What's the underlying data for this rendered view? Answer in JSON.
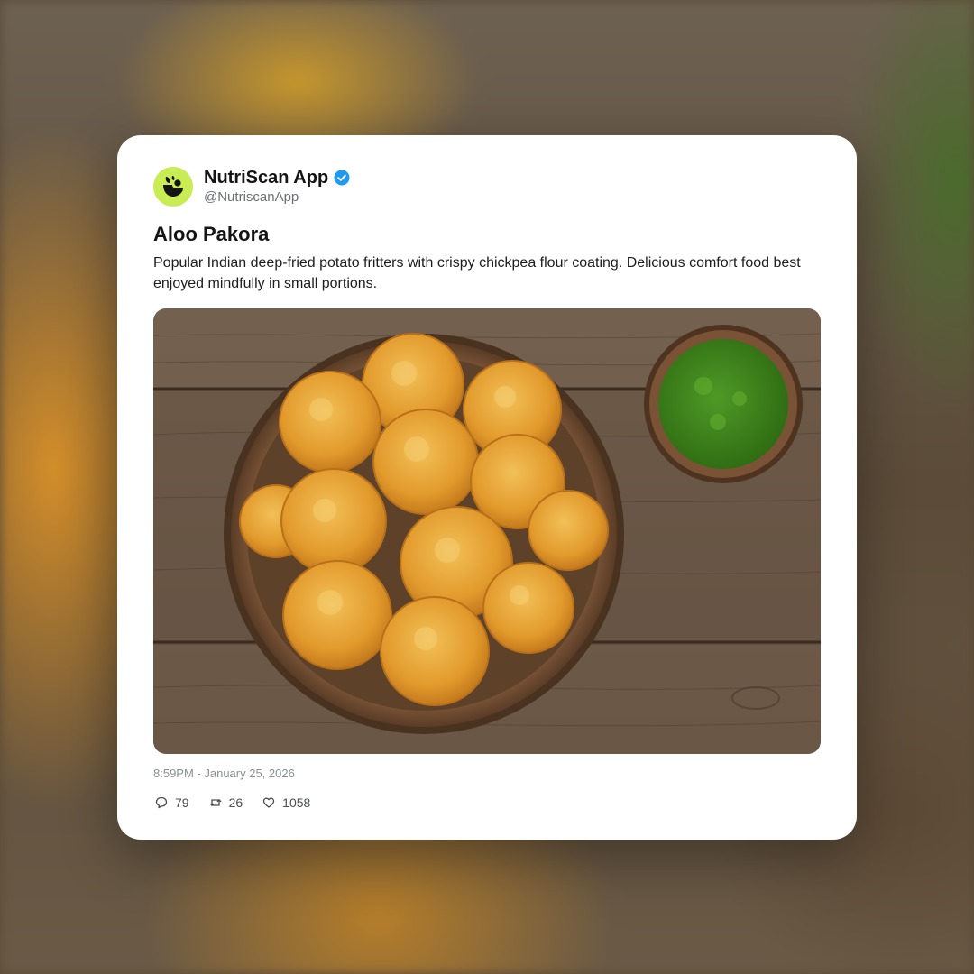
{
  "account": {
    "display_name": "NutriScan App",
    "handle": "@NutriscanApp",
    "verified": true,
    "avatar_icon": "nutriscan-logo-icon",
    "avatar_color": "#c9ec55"
  },
  "post": {
    "title": "Aloo Pakora",
    "description": "Popular Indian deep-fried potato fritters with crispy chickpea flour coating. Delicious comfort food best enjoyed mindfully in small portions.",
    "timestamp": "8:59PM - January 25, 2026"
  },
  "stats": {
    "replies": "79",
    "reposts": "26",
    "likes": "1058"
  },
  "icons": {
    "reply": "comment-icon",
    "repost": "repost-icon",
    "like": "heart-icon",
    "verified": "verified-badge-icon"
  },
  "colors": {
    "verified_blue": "#1d9bf0",
    "card_bg": "#ffffff"
  }
}
